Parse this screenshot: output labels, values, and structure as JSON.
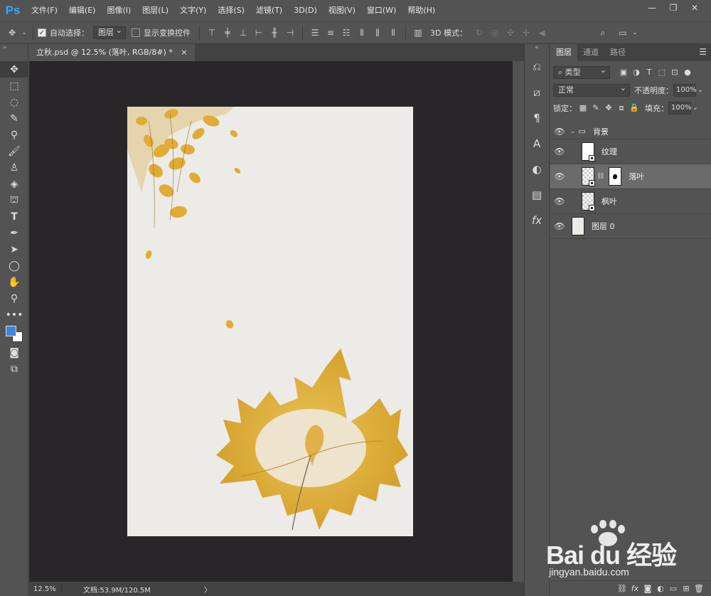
{
  "app": {
    "logo": "Ps",
    "menu": [
      "文件(F)",
      "编辑(E)",
      "图像(I)",
      "图层(L)",
      "文字(Y)",
      "选择(S)",
      "滤镜(T)",
      "3D(D)",
      "视图(V)",
      "窗口(W)",
      "帮助(H)"
    ]
  },
  "options": {
    "auto_select_label": "自动选择：",
    "auto_select_value": "图层",
    "show_transform_label": "显示变换控件",
    "mode_3d_label": "3D 模式："
  },
  "document": {
    "tab_title": "立秋.psd @ 12.5% (落叶, RGB/8#) *",
    "tab_close": "×"
  },
  "status": {
    "zoom": "12.5%",
    "doc_info": "文档:53.9M/120.5M",
    "arrow": "〉"
  },
  "layers_panel": {
    "tabs": [
      "图层",
      "通道",
      "路径"
    ],
    "filter_kind": "类型",
    "blend_mode": "正常",
    "opacity_label": "不透明度：",
    "opacity_value": "100%",
    "lock_label": "锁定：",
    "fill_label": "填充：",
    "fill_value": "100%",
    "group_name": "背景",
    "layers": [
      {
        "name": "纹理"
      },
      {
        "name": "落叶"
      },
      {
        "name": "枫叶"
      },
      {
        "name": "图层 0"
      }
    ]
  },
  "watermark": {
    "text": "Bai du 经验",
    "sub": "jingyan.baidu.com"
  }
}
